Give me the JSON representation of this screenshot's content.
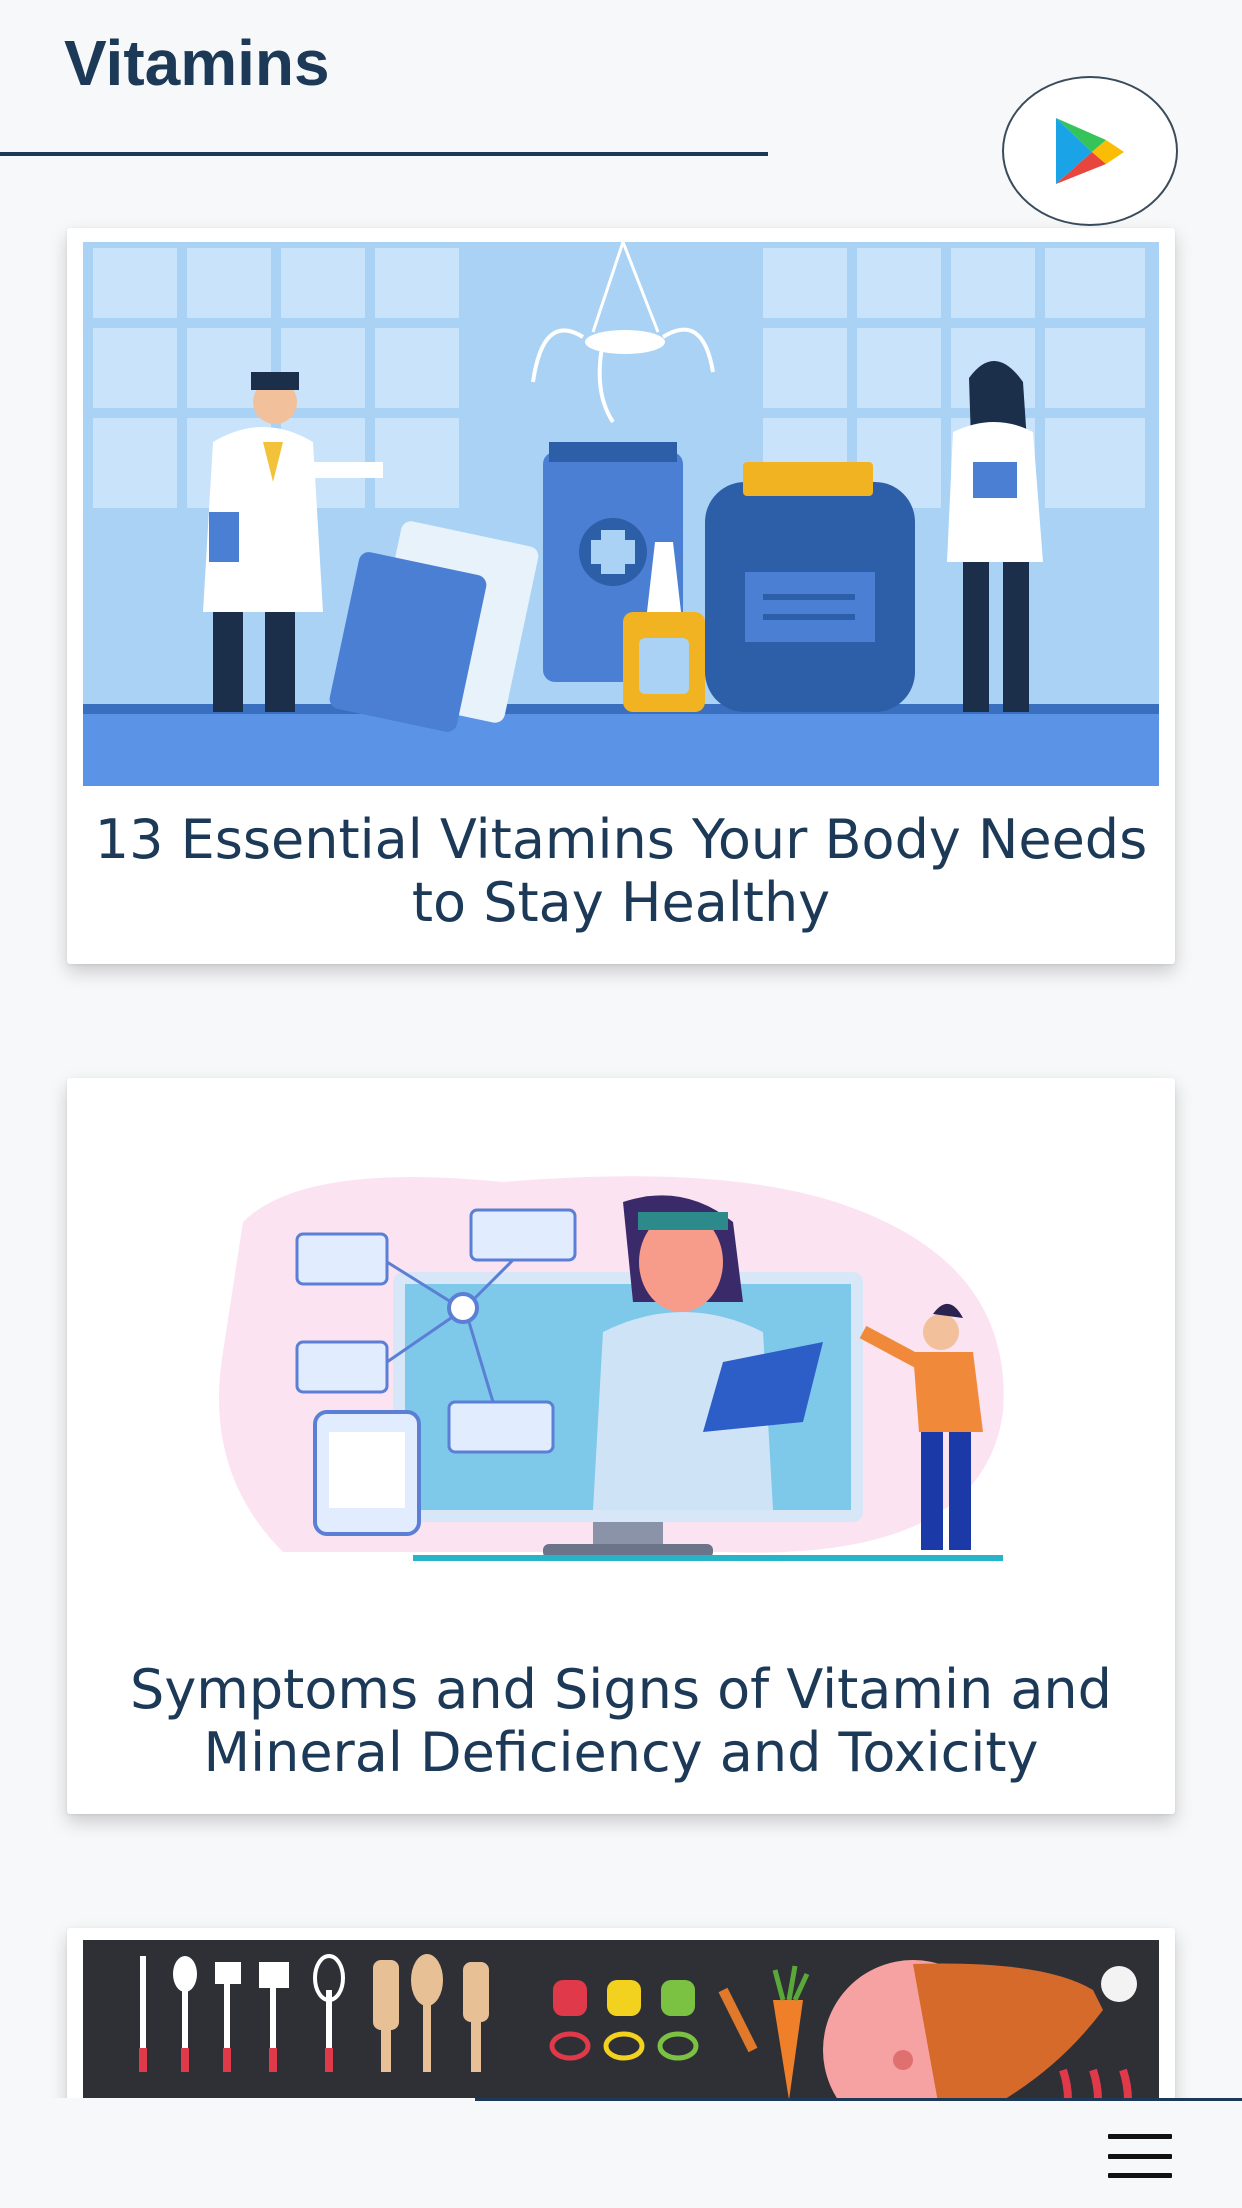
{
  "header": {
    "title": "Vitamins",
    "store_button_icon": "google-play-icon"
  },
  "articles": [
    {
      "title": "13 Essential Vitamins Your Body Needs to Stay Healthy",
      "image": "doctors-medicine-illustration"
    },
    {
      "title": "Symptoms and Signs of Vitamin and Mineral Deficiency and Toxicity",
      "image": "telemedicine-illustration"
    },
    {
      "title": "",
      "image": "kitchen-food-icons-illustration"
    }
  ],
  "bottom_bar": {
    "menu_icon": "hamburger-menu-icon"
  },
  "colors": {
    "primary": "#1c3a57",
    "background": "#f7f8f9",
    "card": "#ffffff"
  }
}
